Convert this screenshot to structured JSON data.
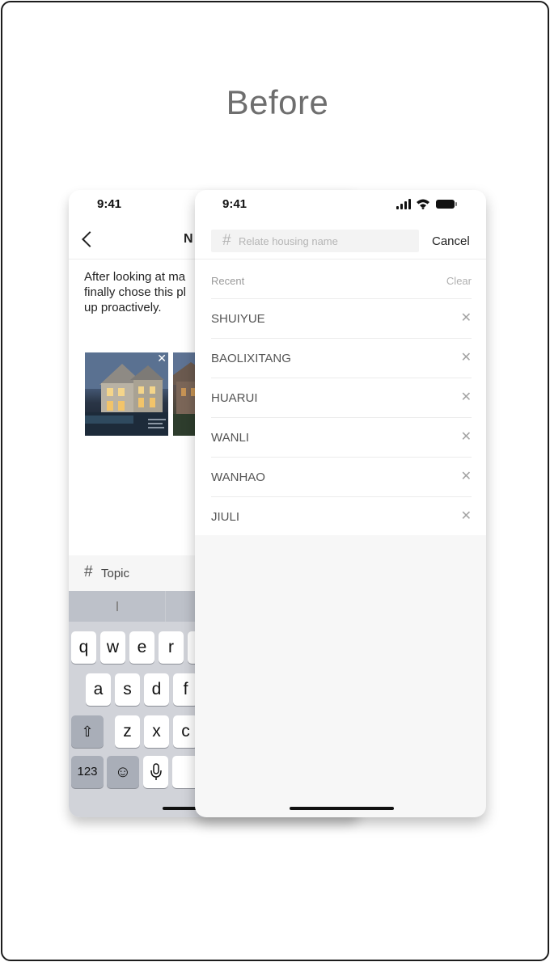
{
  "heading": "Before",
  "compose_screen": {
    "time": "9:41",
    "title": "N",
    "body_lines": [
      "After looking at ma",
      "finally chose this pl",
      "up proactively."
    ],
    "topic_label": "Topic",
    "keyboard": {
      "row1": [
        "q",
        "w",
        "e",
        "r"
      ],
      "row2": [
        "a",
        "s",
        "d",
        "f"
      ],
      "row3": [
        "z",
        "x",
        "c"
      ],
      "numbers_key": "123"
    }
  },
  "search_screen": {
    "time": "9:41",
    "search": {
      "placeholder": "Relate housing name",
      "value": ""
    },
    "cancel_label": "Cancel",
    "recent_label": "Recent",
    "clear_label": "Clear",
    "recent_items": [
      {
        "label": "SHUIYUE"
      },
      {
        "label": "BAOLIXITANG"
      },
      {
        "label": "HUARUI"
      },
      {
        "label": "WANLI"
      },
      {
        "label": "WANHAO"
      },
      {
        "label": "JIULI"
      }
    ]
  }
}
